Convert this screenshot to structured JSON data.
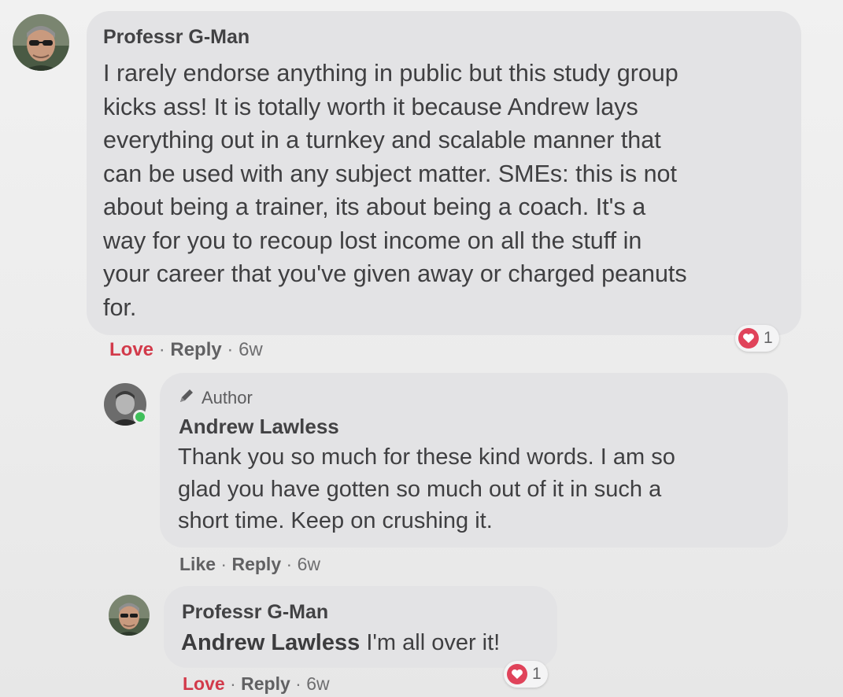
{
  "comments": [
    {
      "author": "Professr G-Man",
      "avatar_icon": "profile-photo",
      "lines": [
        "I rarely endorse anything in public but this study group",
        "kicks ass! It is totally worth it because Andrew lays",
        "everything out in a turnkey and scalable manner that",
        "can be used with any subject matter. SMEs: this is not",
        "about being a trainer, its about being a coach. It's a",
        "way for you to recoup lost income on all the stuff in",
        "your career that you've given away or charged peanuts",
        "for."
      ],
      "actions": {
        "love": "Love",
        "reply": "Reply",
        "time": "6w",
        "separator": "·"
      },
      "reaction": {
        "icon": "heart-icon",
        "count": "1"
      }
    },
    {
      "badge": "Author",
      "badge_icon": "pencil-icon",
      "author": "Andrew Lawless",
      "avatar_icon": "profile-photo",
      "online": true,
      "lines": [
        "Thank you so much for these kind words. I am so",
        "glad you have gotten so much out of it in such a",
        "short time. Keep on crushing it."
      ],
      "actions": {
        "like": "Like",
        "reply": "Reply",
        "time": "6w",
        "separator": "·"
      }
    },
    {
      "author": "Professr G-Man",
      "avatar_icon": "profile-photo",
      "mention": "Andrew Lawless",
      "text": "I'm all over it!",
      "actions": {
        "love": "Love",
        "reply": "Reply",
        "time": "6w",
        "separator": "·"
      },
      "reaction": {
        "icon": "heart-icon",
        "count": "1"
      }
    }
  ],
  "colors": {
    "love": "#d23a4a",
    "heart": "#e0435a",
    "bubble": "#e3e3e5",
    "online": "#3fbf5a"
  }
}
